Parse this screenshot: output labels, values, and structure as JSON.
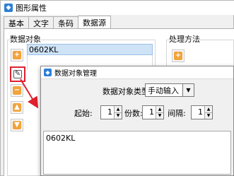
{
  "window": {
    "title": "图形属性"
  },
  "tabs": [
    {
      "label": "基本"
    },
    {
      "label": "文字"
    },
    {
      "label": "条码"
    },
    {
      "label": "数据源"
    }
  ],
  "data_objects": {
    "label": "数据对象",
    "items": [
      "0602KL"
    ]
  },
  "process": {
    "label": "处理方法"
  },
  "side_buttons": [
    {
      "icon": "add-icon"
    },
    {
      "icon": "edit-icon"
    },
    {
      "icon": "delete-icon"
    },
    {
      "icon": "move-up-icon"
    },
    {
      "icon": "move-down-icon"
    }
  ],
  "dialog": {
    "title": "数据对象管理",
    "type_label": "数据对象类型:",
    "type_value": "手动输入",
    "start_label": "起始:",
    "start_value": "1",
    "copies_label": "份数:",
    "copies_value": "1",
    "interval_label": "间隔:",
    "interval_value": "1",
    "content": "0602KL"
  },
  "colors": {
    "highlight_red": "#e0202d",
    "selection_blue": "#cfe3f7",
    "accent_orange": "#f2a33a"
  }
}
